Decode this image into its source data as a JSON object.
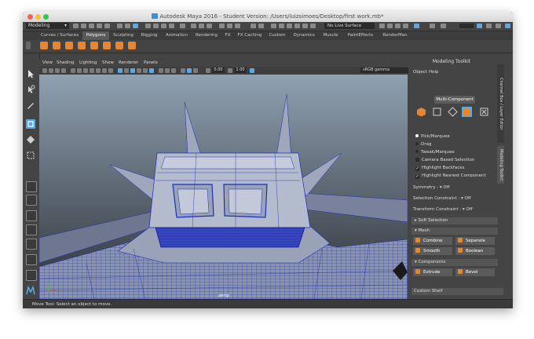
{
  "window": {
    "title": "Autodesk Maya 2016 - Student Version: /Users/luizsimoes/Desktop/first work.mb*"
  },
  "status_line": {
    "mode": "Modeling",
    "live_surface": "No Live Surface"
  },
  "shelf": {
    "tabs": [
      "Curves / Surfaces",
      "Polygons",
      "Sculpting",
      "Rigging",
      "Animation",
      "Rendering",
      "FX",
      "FX Caching",
      "Custom",
      "Dynamics",
      "Muscle",
      "PaintEffects",
      "RenderMan"
    ],
    "active_tab": "Polygons"
  },
  "panel": {
    "menus": [
      "View",
      "Shading",
      "Lighting",
      "Show",
      "Renderer",
      "Panels"
    ],
    "exposure": "0.00",
    "gamma_value": "1.00",
    "color_space": "sRGB gamma",
    "camera": "persp"
  },
  "modeling_toolkit": {
    "title": "Modeling Toolkit",
    "menus": [
      "Object",
      "Help"
    ],
    "mode_button": "Multi-Component",
    "selection_modes": [
      "Pick/Marquee",
      "Drag",
      "Tweak/Marquee"
    ],
    "checkboxes": [
      {
        "label": "Camera Based Selection",
        "checked": false
      },
      {
        "label": "Highlight Backfaces",
        "checked": true
      },
      {
        "label": "Highlight Nearest Component",
        "checked": true
      }
    ],
    "symmetry_label": "Symmetry :",
    "symmetry_value": "Off",
    "selection_constraint_label": "Selection Constraint :",
    "selection_constraint_value": "Off",
    "transform_constraint_label": "Transform Constraint :",
    "transform_constraint_value": "Off",
    "sections": {
      "soft_selection": "Soft Selection",
      "mesh": "Mesh",
      "components": "Components"
    },
    "mesh_buttons": [
      "Combine",
      "Separate",
      "Smooth",
      "Boolean"
    ],
    "component_buttons": [
      "Extrude",
      "Bevel"
    ],
    "custom_shelf": "Custom Shelf"
  },
  "side_tabs": [
    "Channel Box / Layer Editor",
    "Modeling Toolkit"
  ],
  "help_line": "Move Tool: Select an object to move.",
  "colors": {
    "accent": "#5aa9e6",
    "icon_orange": "#e8862e",
    "wire_blue": "#1c2fb8",
    "viewport_top": "#8fa1b2"
  }
}
